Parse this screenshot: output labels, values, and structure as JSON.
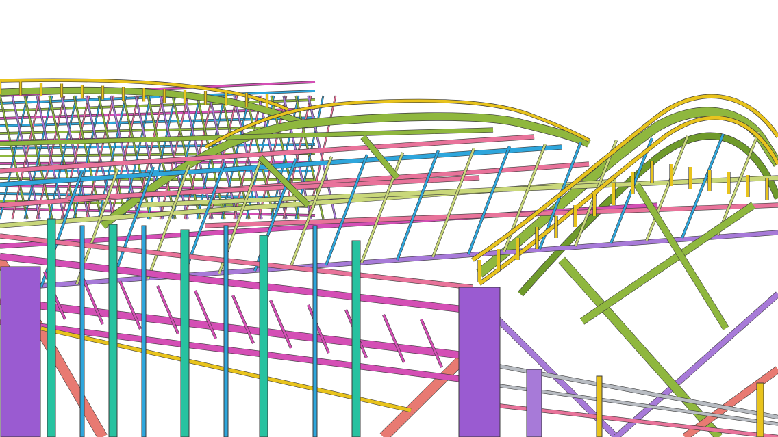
{
  "scene": {
    "subject": "steel-roof-structure-model",
    "colors": {
      "background": "#ffffff",
      "arch_chord": "#8fb73e",
      "arch_chord_dark": "#6f9a2b",
      "handrail": "#e8c31d",
      "purlin_pink": "#e8739a",
      "purlin_magenta": "#d44fb5",
      "tie_blue": "#2ea6dc",
      "column_teal": "#27c2a0",
      "column_purple": "#9a5bd1",
      "brace_purple": "#a77ad8",
      "brace_salmon": "#e87a72",
      "member_lime": "#c9d77a",
      "member_grey": "#b8bcc2",
      "outline": "#3a3a3a"
    }
  }
}
